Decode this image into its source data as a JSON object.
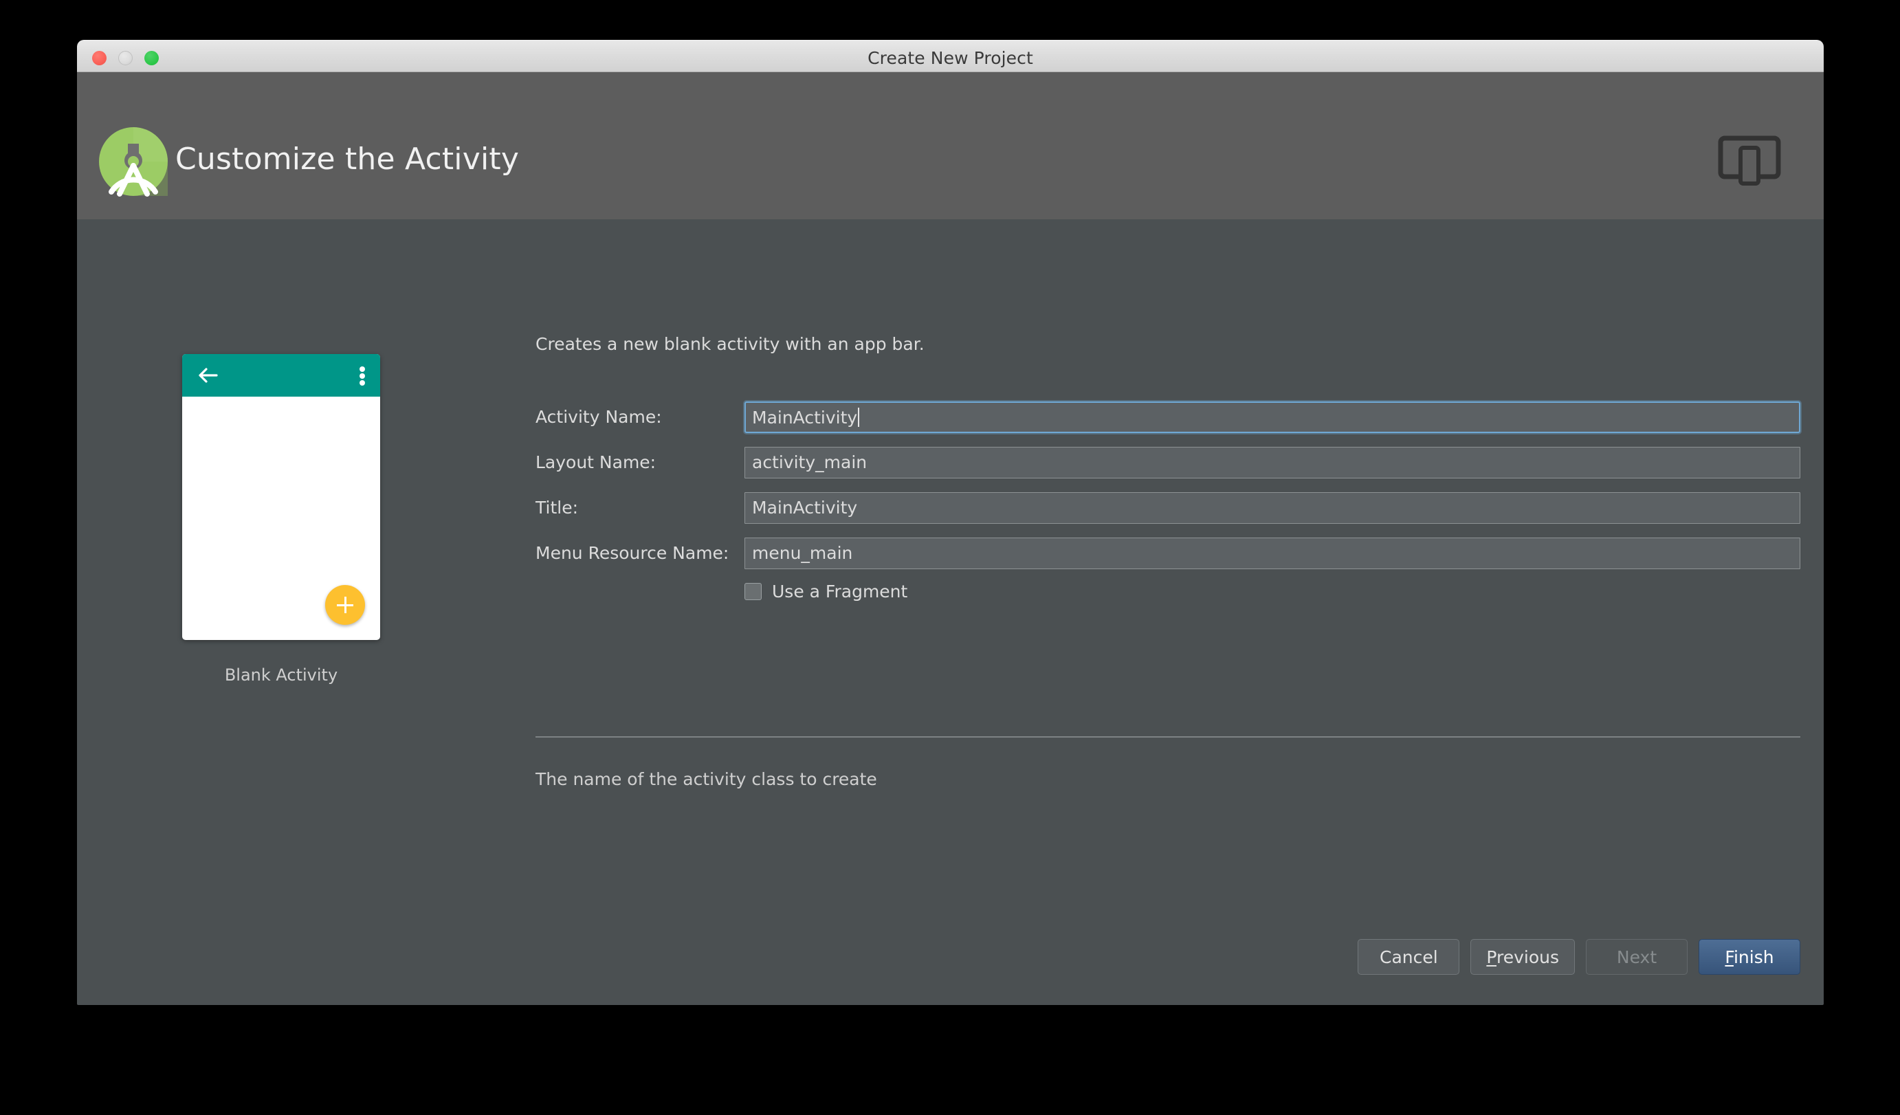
{
  "window": {
    "title": "Create New Project",
    "traffic_lights": [
      "close-button",
      "minimize-button",
      "maximize-button"
    ]
  },
  "header": {
    "title": "Customize the Activity",
    "logo_icon": "android-studio-logo",
    "device_icon": "tablet-and-phone-icon",
    "background_color": "#5d5d5d"
  },
  "preview": {
    "caption": "Blank Activity",
    "appbar_color": "#009688",
    "fab_color": "#fdc02f",
    "back_icon": "back-arrow-icon",
    "overflow_icon": "overflow-menu-icon",
    "fab_icon": "plus-icon"
  },
  "form": {
    "description": "Creates a new blank activity with an app bar.",
    "fields": [
      {
        "label": "Activity Name:",
        "value": "MainActivity",
        "focused": true
      },
      {
        "label": "Layout Name:",
        "value": "activity_main",
        "focused": false
      },
      {
        "label": "Title:",
        "value": "MainActivity",
        "focused": false
      },
      {
        "label": "Menu Resource Name:",
        "value": "menu_main",
        "focused": false
      }
    ],
    "checkbox": {
      "label": "Use a Fragment",
      "checked": false
    },
    "help_text": "The name of the activity class to create"
  },
  "footer": {
    "buttons": [
      {
        "label": "Cancel",
        "state": "normal"
      },
      {
        "label": "Previous",
        "state": "normal",
        "mnemonic": "P"
      },
      {
        "label": "Next",
        "state": "disabled"
      },
      {
        "label": "Finish",
        "state": "primary",
        "mnemonic": "F"
      }
    ]
  },
  "colors": {
    "body_background": "#4b5052",
    "accent_focus": "#6fa8d4",
    "primary_button": "#4e6e95",
    "teal": "#009688",
    "amber": "#fdc02f",
    "logo_green": "#9ccc65"
  }
}
